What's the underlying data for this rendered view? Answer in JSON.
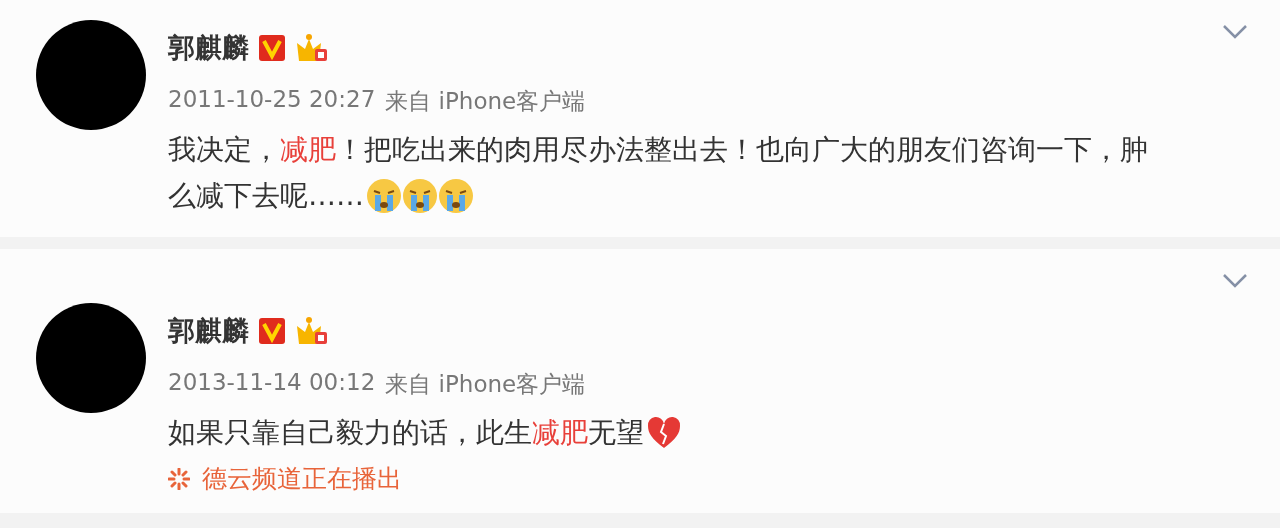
{
  "posts": [
    {
      "author": "郭麒麟",
      "time": "2011-10-25 20:27",
      "source": "来自 iPhone客户端",
      "lines": [
        [
          {
            "text": "我决定，",
            "highlight": false
          },
          {
            "text": "减肥",
            "highlight": true
          },
          {
            "text": "！把吃出来的肉用尽办法整出去！也向广大的朋友们咨询一下，肿",
            "highlight": false
          }
        ],
        [
          {
            "text": "么减下去呢……",
            "highlight": false
          }
        ]
      ],
      "emojis": [
        {
          "kind": "crying"
        },
        {
          "kind": "crying"
        },
        {
          "kind": "crying"
        }
      ]
    },
    {
      "author": "郭麒麟",
      "time": "2013-11-14 00:12",
      "source": "来自 iPhone客户端",
      "lines": [
        [
          {
            "text": "如果只靠自己毅力的话，此生",
            "highlight": false
          },
          {
            "text": "减肥",
            "highlight": true
          },
          {
            "text": "无望",
            "highlight": false
          }
        ]
      ],
      "emojis": [
        {
          "kind": "broken-heart"
        }
      ],
      "live_note": "德云频道正在播出"
    }
  ]
}
